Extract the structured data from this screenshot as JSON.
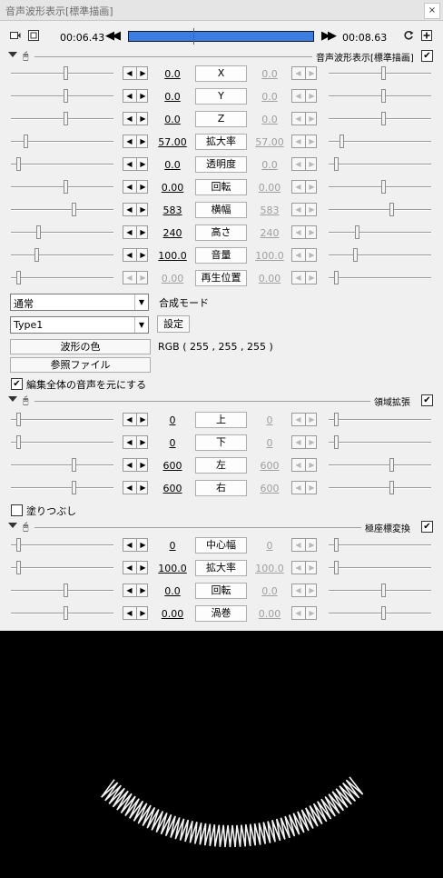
{
  "window": {
    "title": "音声波形表示[標準描画]",
    "close_label": "×"
  },
  "toolbar": {
    "start_time": "00:06.43",
    "end_time": "00:08.63",
    "seek_fraction": 0.35
  },
  "sections": [
    {
      "name": "音声波形表示[標準描画]",
      "checked": true
    },
    {
      "name": "領域拡張",
      "checked": true
    },
    {
      "name": "極座標変換",
      "checked": true
    }
  ],
  "params1": [
    {
      "label": "X",
      "left": "0.0",
      "right": "0.0"
    },
    {
      "label": "Y",
      "left": "0.0",
      "right": "0.0"
    },
    {
      "label": "Z",
      "left": "0.0",
      "right": "0.0"
    },
    {
      "label": "拡大率",
      "left": "57.00",
      "right": "57.00"
    },
    {
      "label": "透明度",
      "left": "0.0",
      "right": "0.0"
    },
    {
      "label": "回転",
      "left": "0.00",
      "right": "0.00"
    },
    {
      "label": "横幅",
      "left": "583",
      "right": "583"
    },
    {
      "label": "高さ",
      "left": "240",
      "right": "240"
    },
    {
      "label": "音量",
      "left": "100.0",
      "right": "100.0"
    },
    {
      "label": "再生位置",
      "left": "0.00",
      "right": "0.00"
    }
  ],
  "blend": {
    "value": "通常",
    "label": "合成モード"
  },
  "type": {
    "value": "Type1",
    "settings_label": "設定"
  },
  "wave_color": {
    "button": "波形の色",
    "value": "RGB ( 255 , 255 , 255 )"
  },
  "ref_file": {
    "button": "参照ファイル"
  },
  "whole_edit": {
    "label": "編集全体の音声を元にする",
    "checked": true
  },
  "params2": [
    {
      "label": "上",
      "left": "0",
      "right": "0"
    },
    {
      "label": "下",
      "left": "0",
      "right": "0"
    },
    {
      "label": "左",
      "left": "600",
      "right": "600"
    },
    {
      "label": "右",
      "left": "600",
      "right": "600"
    }
  ],
  "fill": {
    "label": "塗りつぶし",
    "checked": false
  },
  "params3": [
    {
      "label": "中心幅",
      "left": "0",
      "right": "0"
    },
    {
      "label": "拡大率",
      "left": "100.0",
      "right": "100.0"
    },
    {
      "label": "回転",
      "left": "0.0",
      "right": "0.0"
    },
    {
      "label": "渦巻",
      "left": "0.00",
      "right": "0.00"
    }
  ]
}
